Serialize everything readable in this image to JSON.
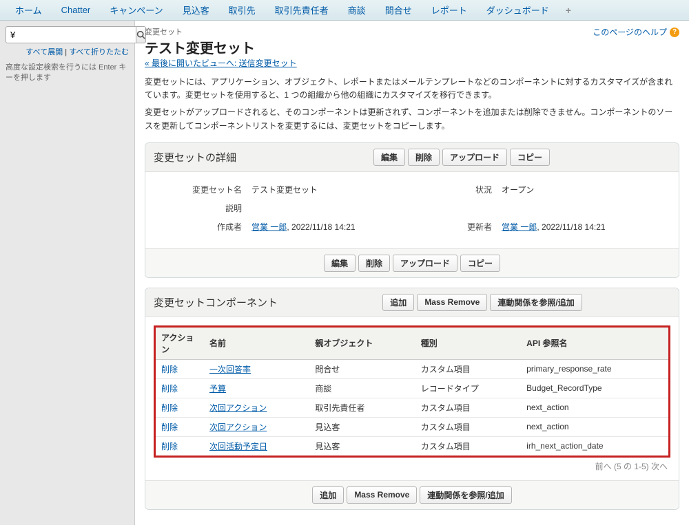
{
  "tabs": {
    "items": [
      "ホーム",
      "Chatter",
      "キャンペーン",
      "見込客",
      "取引先",
      "取引先責任者",
      "商談",
      "問合せ",
      "レポート",
      "ダッシュボード"
    ]
  },
  "sidebar": {
    "search_placeholder": "¥",
    "expand_all": "すべて展開",
    "collapse_all": "すべて折りたたむ",
    "hint": "高度な設定検索を行うには Enter キーを押します"
  },
  "header": {
    "section_label": "変更セット",
    "title": "テスト変更セット",
    "back_link": "最後に開いたビューへ: 送信変更セット",
    "help_text": "このページのヘルプ"
  },
  "intro": {
    "p1": "変更セットには、アプリケーション、オブジェクト、レポートまたはメールテンプレートなどのコンポーネントに対するカスタマイズが含まれています。変更セットを使用すると、1 つの組織から他の組織にカスタマイズを移行できます。",
    "p2": "変更セットがアップロードされると、そのコンポーネントは更新されず、コンポーネントを追加または削除できません。コンポーネントのソースを更新してコンポーネントリストを変更するには、変更セットをコピーします。"
  },
  "detail": {
    "panel_title": "変更セットの詳細",
    "buttons": {
      "edit": "編集",
      "delete": "削除",
      "upload": "アップロード",
      "copy": "コピー"
    },
    "labels": {
      "name": "変更セット名",
      "desc": "説明",
      "creator": "作成者",
      "status": "状況",
      "updater": "更新者"
    },
    "name": "テスト変更セット",
    "desc": "",
    "creator_name": "営業 一郎",
    "creator_date": "2022/11/18 14:21",
    "status": "オープン",
    "updater_name": "営業 一郎",
    "updater_date": "2022/11/18 14:21"
  },
  "components": {
    "panel_title": "変更セットコンポーネント",
    "buttons": {
      "add": "追加",
      "mass_remove": "Mass Remove",
      "dependencies": "連動関係を参照/追加"
    },
    "columns": {
      "action": "アクション",
      "name": "名前",
      "parent": "親オブジェクト",
      "type": "種別",
      "api": "API 参照名"
    },
    "action_label": "削除",
    "rows": [
      {
        "name": "一次回答率",
        "parent": "問合せ",
        "type": "カスタム項目",
        "api": "primary_response_rate"
      },
      {
        "name": "予算",
        "parent": "商談",
        "type": "レコードタイプ",
        "api": "Budget_RecordType"
      },
      {
        "name": "次回アクション",
        "parent": "取引先責任者",
        "type": "カスタム項目",
        "api": "next_action"
      },
      {
        "name": "次回アクション",
        "parent": "見込客",
        "type": "カスタム項目",
        "api": "next_action"
      },
      {
        "name": "次回活動予定日",
        "parent": "見込客",
        "type": "カスタム項目",
        "api": "irh_next_action_date"
      }
    ],
    "pager": {
      "prev": "前へ",
      "range": "(5 の 1-5)",
      "next": "次へ"
    }
  }
}
